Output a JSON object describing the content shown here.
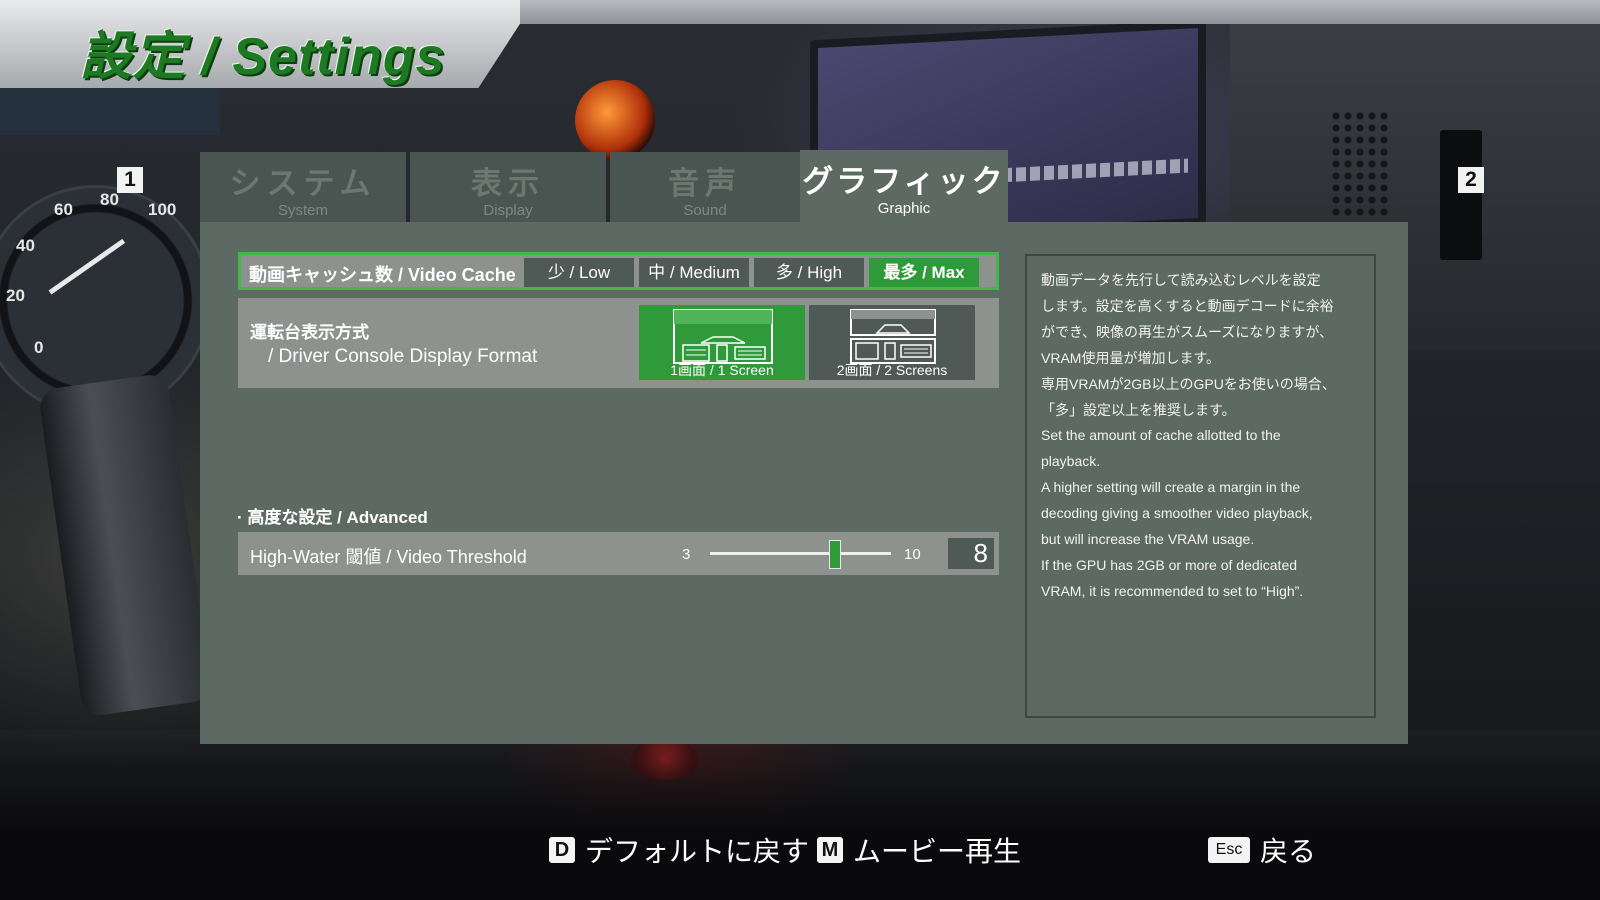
{
  "title": "設定 / Settings",
  "background": {
    "screen_marks": [
      "1",
      "2"
    ],
    "gauge_labels": [
      "60",
      "80",
      "100",
      "40",
      "20",
      "0"
    ]
  },
  "tabs": [
    {
      "jp": "システム",
      "en": "System",
      "active": false
    },
    {
      "jp": "表示",
      "en": "Display",
      "active": false
    },
    {
      "jp": "音声",
      "en": "Sound",
      "active": false
    },
    {
      "jp": "グラフィック",
      "en": "Graphic",
      "active": true
    }
  ],
  "video_cache": {
    "label": "動画キャッシュ数 / Video Cache",
    "options": [
      "少 / Low",
      "中 / Medium",
      "多 / High",
      "最多 / Max"
    ],
    "selected": "最多 / Max"
  },
  "display_format": {
    "label_jp": "運転台表示方式",
    "label_en": "/ Driver Console Display Format",
    "options": [
      "1画面 / 1 Screen",
      "2画面 / 2 Screens"
    ],
    "selected": "1画面 / 1 Screen"
  },
  "advanced": {
    "heading": "高度な設定 / Advanced",
    "threshold": {
      "label": "High-Water 閾値 / Video Threshold",
      "min": "3",
      "max": "10",
      "value": "8"
    }
  },
  "description": [
    "動画データを先行して読み込むレベルを設定",
    "します。設定を高くすると動画デコードに余裕",
    "ができ、映像の再生がスムーズになりますが、",
    "VRAM使用量が増加します。",
    "専用VRAMが2GB以上のGPUをお使いの場合、",
    "「多」設定以上を推奨します。",
    "Set the amount of cache allotted to the",
    "playback.",
    "A higher setting will create a margin in the",
    "decoding giving a smoother video playback,",
    "but will increase the VRAM usage.",
    "If the GPU has 2GB or more of dedicated",
    "VRAM, it is recommended to set to “High”."
  ],
  "footer": {
    "default": {
      "key": "D",
      "label": "デフォルトに戻す"
    },
    "movie": {
      "key": "M",
      "label": "ムービー再生"
    },
    "back": {
      "key": "Esc",
      "label": "戻る"
    }
  },
  "colors": {
    "accent_green": "#2f9a3a",
    "panel_bg": "#5d6963",
    "row_bg": "#8d928e",
    "title_green": "#1d7a22"
  }
}
